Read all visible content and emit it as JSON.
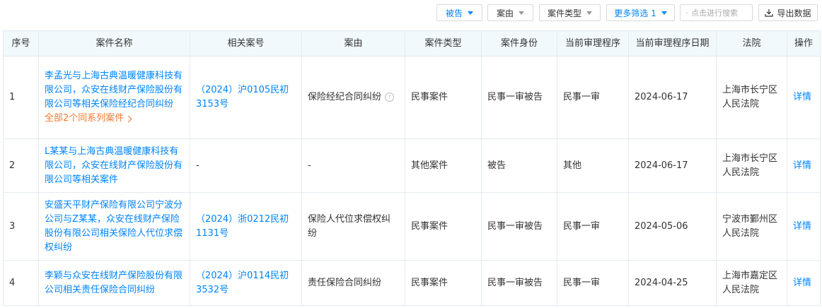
{
  "toolbar": {
    "filter_role": "被告",
    "filter_reason": "案由",
    "filter_type": "案件类型",
    "more_filters": "更多筛选 1",
    "search_placeholder": "点击进行搜索",
    "export": "导出数据"
  },
  "columns": [
    "序号",
    "案件名称",
    "相关案号",
    "案由",
    "案件类型",
    "案件身份",
    "当前审理程序",
    "当前审理程序日期",
    "法院",
    "操作"
  ],
  "rows": [
    {
      "index": "1",
      "name": "李孟光与上海古典温暖健康科技有限公司，众安在线财产保险股份有限公司等相关保险经纪合同纠纷",
      "series": "全部2个同系列案件",
      "case_no": "（2024）沪0105民初3153号",
      "reason": "保险经纪合同纠纷",
      "case_type": "民事案件",
      "role": "民事一审被告",
      "stage": "民事一审",
      "date": "2024-06-17",
      "court": "上海市长宁区人民法院",
      "action": "详情"
    },
    {
      "index": "2",
      "name": "L某某与上海古典温暖健康科技有限公司，众安在线财产保险股份有限公司等相关案件",
      "case_no": "-",
      "reason": "-",
      "case_type": "其他案件",
      "role": "被告",
      "stage": "其他",
      "date": "2024-06-17",
      "court": "上海市长宁区人民法院",
      "action": "详情"
    },
    {
      "index": "3",
      "name": "安盛天平财产保险有限公司宁波分公司与Z某某，众安在线财产保险股份有限公司相关保险人代位求偿权纠纷",
      "case_no": "（2024）浙0212民初1131号",
      "reason": "保险人代位求偿权纠纷",
      "case_type": "民事案件",
      "role": "民事一审被告",
      "stage": "民事一审",
      "date": "2024-05-06",
      "court": "宁波市鄞州区人民法院",
      "action": "详情"
    },
    {
      "index": "4",
      "name": "李颖与众安在线财产保险股份有限公司相关责任保险合同纠纷",
      "case_no": "（2024）沪0114民初3532号",
      "reason": "责任保险合同纠纷",
      "case_type": "民事案件",
      "role": "民事一审被告",
      "stage": "民事一审",
      "date": "2024-04-25",
      "court": "上海市嘉定区人民法院",
      "action": "详情"
    }
  ]
}
